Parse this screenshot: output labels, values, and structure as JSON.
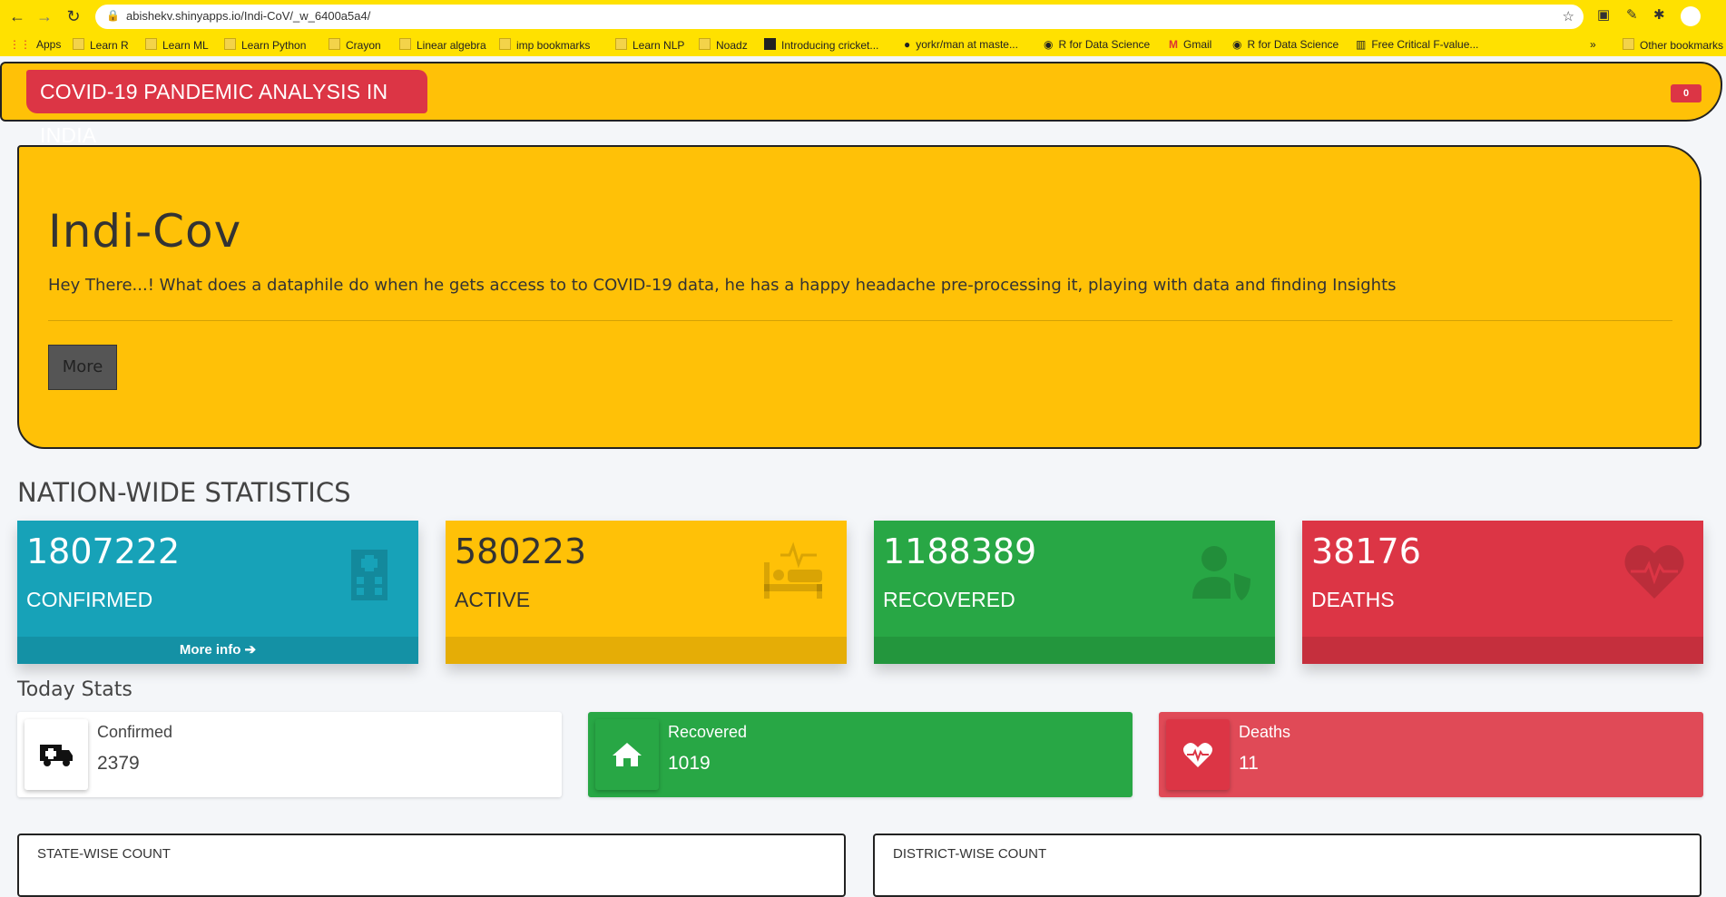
{
  "browser": {
    "url": "abishekv.shinyapps.io/Indi-CoV/_w_6400a5a4/",
    "bookmarks": [
      "Apps",
      "Learn R",
      "Learn ML",
      "Learn Python",
      "Crayon",
      "Linear algebra",
      "imp bookmarks",
      "Learn NLP",
      "Noadz",
      "Introducing cricket...",
      "yorkr/man at maste...",
      "R for Data Science",
      "Gmail",
      "R for Data Science",
      "Free Critical F-value..."
    ],
    "other_bookmarks": "Other bookmarks"
  },
  "header": {
    "brand": "COVID-19 PANDEMIC ANALYSIS IN INDIA",
    "badge": "0"
  },
  "jumbotron": {
    "title": "Indi-Cov",
    "text": "Hey There...! What does a dataphile do when he gets access to to COVID-19 data, he has a happy headache pre-processing it, playing with data and finding Insights",
    "button": "More"
  },
  "nation": {
    "title": "NATION-WIDE STATISTICS",
    "boxes": [
      {
        "value": "1807222",
        "label": "CONFIRMED",
        "footer": "More info ➔",
        "icon": "hospital-icon",
        "color": "#17a2b8"
      },
      {
        "value": "580223",
        "label": "ACTIVE",
        "footer": "",
        "icon": "bed-pulse-icon",
        "color": "#ffc107"
      },
      {
        "value": "1188389",
        "label": "RECOVERED",
        "footer": "",
        "icon": "user-shield-icon",
        "color": "#28a745"
      },
      {
        "value": "38176",
        "label": "DEATHS",
        "footer": "",
        "icon": "heartbeat-icon",
        "color": "#dc3545"
      }
    ]
  },
  "today": {
    "title": "Today Stats",
    "boxes": [
      {
        "label": "Confirmed",
        "value": "2379",
        "icon": "ambulance-icon"
      },
      {
        "label": "Recovered",
        "value": "1019",
        "icon": "home-icon"
      },
      {
        "label": "Deaths",
        "value": "11",
        "icon": "heartbeat-icon"
      }
    ]
  },
  "cards": {
    "state": "STATE-WISE COUNT",
    "district": "DISTRICT-WISE COUNT"
  }
}
